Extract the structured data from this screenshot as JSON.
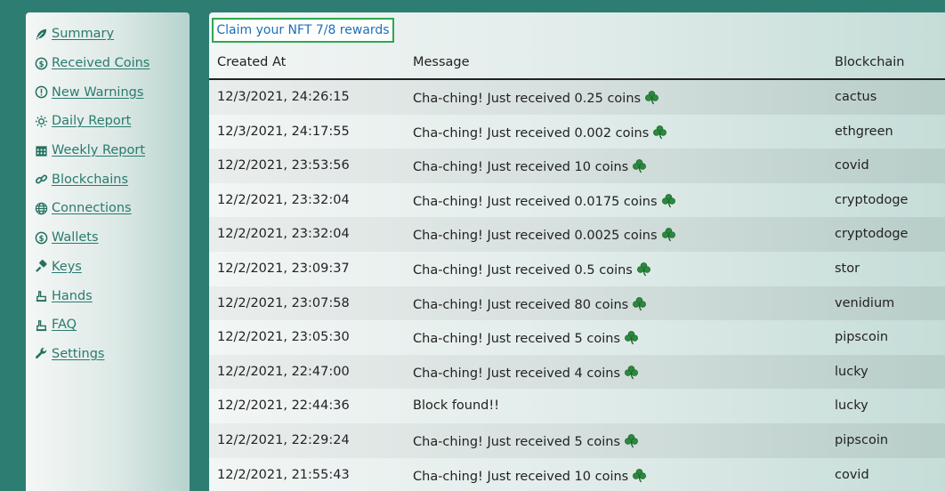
{
  "sidebar": {
    "items": [
      {
        "label": "Summary",
        "icon": "leaf-icon"
      },
      {
        "label": "Received Coins",
        "icon": "dollar-coin-icon"
      },
      {
        "label": "New Warnings",
        "icon": "exclamation-circle-icon"
      },
      {
        "label": "Daily Report",
        "icon": "sun-icon"
      },
      {
        "label": "Weekly Report",
        "icon": "calendar-icon"
      },
      {
        "label": "Blockchains",
        "icon": "link-icon"
      },
      {
        "label": "Connections",
        "icon": "globe-icon"
      },
      {
        "label": "Wallets",
        "icon": "dollar-coin-icon"
      },
      {
        "label": "Keys",
        "icon": "key-icon"
      },
      {
        "label": "Hands",
        "icon": "hand-icon"
      },
      {
        "label": "FAQ",
        "icon": "hand-icon"
      },
      {
        "label": "Settings",
        "icon": "wrench-icon"
      }
    ]
  },
  "main": {
    "claim_label": "Claim your NFT 7/8 rewards",
    "columns": [
      "Created At",
      "Message",
      "Blockchain"
    ],
    "rows": [
      {
        "created": "12/3/2021, 24:26:15",
        "message": "Cha-ching! Just received 0.25 coins",
        "clover": true,
        "chain": "cactus"
      },
      {
        "created": "12/3/2021, 24:17:55",
        "message": "Cha-ching! Just received 0.002 coins",
        "clover": true,
        "chain": "ethgreen"
      },
      {
        "created": "12/2/2021, 23:53:56",
        "message": "Cha-ching! Just received 10 coins",
        "clover": true,
        "chain": "covid"
      },
      {
        "created": "12/2/2021, 23:32:04",
        "message": "Cha-ching! Just received 0.0175 coins",
        "clover": true,
        "chain": "cryptodoge"
      },
      {
        "created": "12/2/2021, 23:32:04",
        "message": "Cha-ching! Just received 0.0025 coins",
        "clover": true,
        "chain": "cryptodoge"
      },
      {
        "created": "12/2/2021, 23:09:37",
        "message": "Cha-ching! Just received 0.5 coins",
        "clover": true,
        "chain": "stor"
      },
      {
        "created": "12/2/2021, 23:07:58",
        "message": "Cha-ching! Just received 80 coins",
        "clover": true,
        "chain": "venidium"
      },
      {
        "created": "12/2/2021, 23:05:30",
        "message": "Cha-ching! Just received 5 coins",
        "clover": true,
        "chain": "pipscoin"
      },
      {
        "created": "12/2/2021, 22:47:00",
        "message": "Cha-ching! Just received 4 coins",
        "clover": true,
        "chain": "lucky"
      },
      {
        "created": "12/2/2021, 22:44:36",
        "message": "Block found!!",
        "clover": false,
        "chain": "lucky"
      },
      {
        "created": "12/2/2021, 22:29:24",
        "message": "Cha-ching! Just received 5 coins",
        "clover": true,
        "chain": "pipscoin"
      },
      {
        "created": "12/2/2021, 21:55:43",
        "message": "Cha-ching! Just received 10 coins",
        "clover": true,
        "chain": "covid"
      }
    ]
  },
  "colors": {
    "background": "#2e7d73",
    "link": "#2a7a6e",
    "claim_border": "#2fa84f",
    "claim_text": "#1d6fb8",
    "clover": "#2a8a3e"
  }
}
